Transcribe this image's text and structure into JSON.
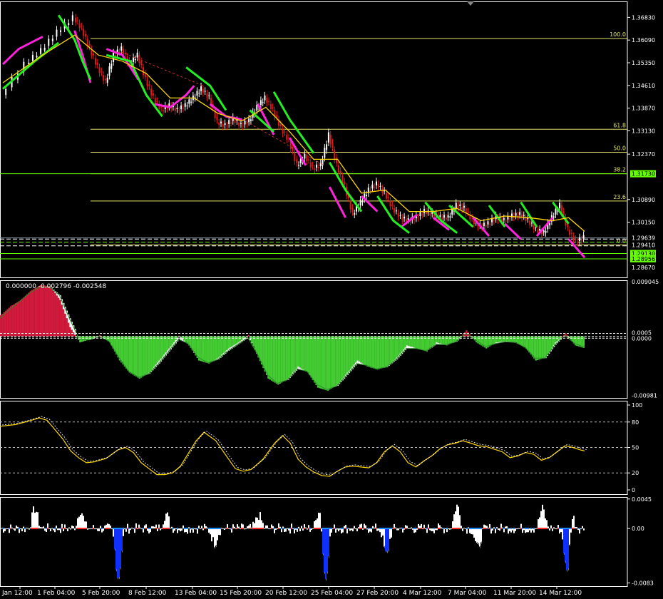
{
  "chart_data": [
    {
      "type": "candlestick",
      "panel": "price",
      "ylim": [
        1.2835,
        1.3735
      ],
      "y_ticks": [
        "1.36830",
        "1.36090",
        "1.35350",
        "1.34610",
        "1.33870",
        "1.33130",
        "1.32370",
        "1.30890",
        "1.30150"
      ],
      "price_tags": [
        {
          "label": "1.31730",
          "value": 1.3173,
          "color": "#66ff00",
          "text_color": "#000000"
        },
        {
          "label": "1.29639",
          "value": 1.29639,
          "color": "#000000",
          "text_color": "#ffffff"
        },
        {
          "label": "1.29410",
          "value": 1.2941,
          "color": "#000000",
          "text_color": "#ffffff"
        },
        {
          "label": "1.29130",
          "value": 1.2913,
          "color": "#66ff00",
          "text_color": "#000000"
        },
        {
          "label": "1.28956",
          "value": 1.28956,
          "color": "#66ff00",
          "text_color": "#000000"
        },
        {
          "label": "1.28670",
          "value": 1.2867,
          "color": "#000000",
          "text_color": "#ffffff"
        }
      ],
      "fib_levels": [
        {
          "label": "100.0",
          "value": 1.3614
        },
        {
          "label": "61.8",
          "value": 1.3318
        },
        {
          "label": "50.0",
          "value": 1.3243
        },
        {
          "label": "38.2",
          "value": 1.3173
        },
        {
          "label": "23.6",
          "value": 1.3084
        },
        {
          "label": "0.0",
          "value": 1.2941
        }
      ],
      "close_path": [
        [
          0,
          1.343
        ],
        [
          3,
          1.353
        ],
        [
          5,
          1.3575
        ],
        [
          7,
          1.3635
        ],
        [
          9,
          1.3682
        ],
        [
          10,
          1.3645
        ],
        [
          11,
          1.358
        ],
        [
          12,
          1.352
        ],
        [
          13,
          1.347
        ],
        [
          14,
          1.356
        ],
        [
          15,
          1.358
        ],
        [
          16,
          1.353
        ],
        [
          17,
          1.356
        ],
        [
          18,
          1.348
        ],
        [
          19,
          1.342
        ],
        [
          20,
          1.338
        ],
        [
          21,
          1.3395
        ],
        [
          22,
          1.338
        ],
        [
          23,
          1.3395
        ],
        [
          24,
          1.342
        ],
        [
          25,
          1.345
        ],
        [
          26,
          1.342
        ],
        [
          27,
          1.334
        ],
        [
          28,
          1.333
        ],
        [
          29,
          1.335
        ],
        [
          30,
          1.333
        ],
        [
          31,
          1.3345
        ],
        [
          32,
          1.339
        ],
        [
          33,
          1.342
        ],
        [
          34,
          1.338
        ],
        [
          35,
          1.332
        ],
        [
          36,
          1.328
        ],
        [
          37,
          1.32
        ],
        [
          38,
          1.323
        ],
        [
          39,
          1.319
        ],
        [
          40,
          1.32
        ],
        [
          41,
          1.33
        ],
        [
          42,
          1.32
        ],
        [
          43,
          1.313
        ],
        [
          44,
          1.304
        ],
        [
          45,
          1.308
        ],
        [
          46,
          1.312
        ],
        [
          47,
          1.314
        ],
        [
          48,
          1.311
        ],
        [
          49,
          1.306
        ],
        [
          50,
          1.303
        ],
        [
          51,
          1.302
        ],
        [
          52,
          1.303
        ],
        [
          53,
          1.305
        ],
        [
          54,
          1.304
        ],
        [
          55,
          1.303
        ],
        [
          56,
          1.303
        ],
        [
          57,
          1.307
        ],
        [
          58,
          1.306
        ],
        [
          59,
          1.302
        ],
        [
          60,
          1.3
        ],
        [
          61,
          1.301
        ],
        [
          62,
          1.303
        ],
        [
          63,
          1.302
        ],
        [
          64,
          1.3035
        ],
        [
          65,
          1.304
        ],
        [
          66,
          1.302
        ],
        [
          67,
          1.299
        ],
        [
          68,
          1.298
        ],
        [
          69,
          1.303
        ],
        [
          70,
          1.307
        ],
        [
          71,
          1.299
        ],
        [
          72,
          1.295
        ],
        [
          73,
          1.2965
        ]
      ],
      "ma_yellow": [
        [
          0,
          1.347
        ],
        [
          5,
          1.356
        ],
        [
          9,
          1.3625
        ],
        [
          12,
          1.356
        ],
        [
          15,
          1.354
        ],
        [
          18,
          1.35
        ],
        [
          21,
          1.342
        ],
        [
          24,
          1.342
        ],
        [
          27,
          1.337
        ],
        [
          30,
          1.3345
        ],
        [
          33,
          1.339
        ],
        [
          36,
          1.331
        ],
        [
          39,
          1.322
        ],
        [
          42,
          1.322
        ],
        [
          45,
          1.311
        ],
        [
          48,
          1.312
        ],
        [
          51,
          1.305
        ],
        [
          54,
          1.305
        ],
        [
          57,
          1.306
        ],
        [
          60,
          1.302
        ],
        [
          63,
          1.3035
        ],
        [
          66,
          1.303
        ],
        [
          69,
          1.302
        ],
        [
          71,
          1.303
        ],
        [
          73,
          1.2985
        ]
      ],
      "green_segments": [
        [
          [
            0,
            1.345
          ],
          [
            4,
            1.354
          ],
          [
            7,
            1.36
          ]
        ],
        [
          [
            7,
            1.369
          ],
          [
            9,
            1.361
          ],
          [
            10,
            1.354
          ],
          [
            11,
            1.348
          ]
        ],
        [
          [
            13,
            1.356
          ],
          [
            16,
            1.354
          ],
          [
            18,
            1.343
          ],
          [
            20,
            1.336
          ]
        ],
        [
          [
            23,
            1.352
          ],
          [
            26,
            1.346
          ],
          [
            28,
            1.338
          ]
        ],
        [
          [
            31,
            1.338
          ],
          [
            34,
            1.331
          ]
        ],
        [
          [
            34,
            1.344
          ],
          [
            36,
            1.335
          ],
          [
            39,
            1.324
          ]
        ],
        [
          [
            41,
            1.321
          ],
          [
            43,
            1.312
          ],
          [
            45,
            1.305
          ]
        ],
        [
          [
            47,
            1.31
          ],
          [
            49,
            1.302
          ],
          [
            51,
            1.298
          ]
        ],
        [
          [
            53,
            1.308
          ],
          [
            55,
            1.302
          ],
          [
            57,
            1.298
          ]
        ],
        [
          [
            56,
            1.307
          ],
          [
            59,
            1.3
          ]
        ],
        [
          [
            61,
            1.307
          ],
          [
            63,
            1.3
          ]
        ],
        [
          [
            65,
            1.308
          ],
          [
            67,
            1.3
          ]
        ],
        [
          [
            69,
            1.308
          ],
          [
            71,
            1.301
          ]
        ]
      ],
      "magenta_segments": [
        [
          [
            0,
            1.353
          ],
          [
            2,
            1.358
          ],
          [
            5,
            1.362
          ]
        ],
        [
          [
            9,
            1.364
          ],
          [
            10,
            1.356
          ],
          [
            11,
            1.347
          ]
        ],
        [
          [
            13,
            1.358
          ],
          [
            15,
            1.356
          ],
          [
            17,
            1.348
          ]
        ],
        [
          [
            19,
            1.34
          ],
          [
            21,
            1.339
          ],
          [
            23,
            1.343
          ],
          [
            24,
            1.346
          ]
        ],
        [
          [
            26,
            1.34
          ],
          [
            28,
            1.336
          ],
          [
            30,
            1.335
          ]
        ],
        [
          [
            32,
            1.34
          ],
          [
            34,
            1.33
          ]
        ],
        [
          [
            36,
            1.329
          ],
          [
            38,
            1.32
          ]
        ],
        [
          [
            41,
            1.313
          ],
          [
            43,
            1.303
          ]
        ],
        [
          [
            45,
            1.31
          ],
          [
            47,
            1.305
          ]
        ],
        [
          [
            50,
            1.3
          ],
          [
            52,
            1.304
          ]
        ],
        [
          [
            54,
            1.303
          ],
          [
            56,
            1.299
          ]
        ],
        [
          [
            59,
            1.303
          ],
          [
            61,
            1.297
          ]
        ],
        [
          [
            63,
            1.301
          ],
          [
            65,
            1.296
          ]
        ],
        [
          [
            67,
            1.297
          ],
          [
            69,
            1.303
          ]
        ],
        [
          [
            71,
            1.296
          ],
          [
            73,
            1.29
          ]
        ]
      ]
    },
    {
      "type": "histogram",
      "panel": "oscillator",
      "header": "0.000000 -0.002796 -0.002548",
      "ylim": [
        -0.0102,
        0.0093
      ],
      "y_ticks": [
        "0.009045",
        "-0.00981"
      ],
      "level_tags": [
        "0.0005",
        "0.0000"
      ],
      "values": [
        0.0035,
        0.005,
        0.006,
        0.0075,
        0.0085,
        0.0083,
        0.006,
        0.0015,
        -0.001,
        -0.0005,
        0.0002,
        -0.001,
        -0.004,
        -0.006,
        -0.007,
        -0.006,
        -0.004,
        -0.002,
        0.0001,
        -0.0015,
        -0.004,
        -0.0045,
        -0.0035,
        -0.002,
        -0.001,
        0.0002,
        -0.0035,
        -0.007,
        -0.008,
        -0.007,
        -0.005,
        -0.006,
        -0.0085,
        -0.009,
        -0.008,
        -0.006,
        -0.004,
        -0.005,
        -0.0055,
        -0.005,
        -0.0035,
        -0.0015,
        -0.002,
        -0.0025,
        -0.001,
        -0.0015,
        -0.0008,
        0.001,
        -0.001,
        -0.002,
        -0.001,
        -0.0008,
        -0.001,
        -0.002,
        -0.004,
        -0.0035,
        -0.001,
        0.0005,
        -0.0015,
        -0.002
      ],
      "signal": [
        0.003,
        0.0045,
        0.0058,
        0.0072,
        0.0082,
        0.0082,
        0.0068,
        0.003,
        -0.0005,
        -0.0006,
        0.0,
        -0.0008,
        -0.0035,
        -0.0058,
        -0.0068,
        -0.0062,
        -0.0045,
        -0.0025,
        -0.0005,
        -0.0012,
        -0.0035,
        -0.0044,
        -0.0038,
        -0.0024,
        -0.0013,
        -0.0002,
        -0.003,
        -0.0064,
        -0.0078,
        -0.0072,
        -0.0054,
        -0.0058,
        -0.008,
        -0.0088,
        -0.0082,
        -0.0064,
        -0.0045,
        -0.0048,
        -0.0054,
        -0.0051,
        -0.0038,
        -0.002,
        -0.002,
        -0.0024,
        -0.0013,
        -0.0014,
        -0.0009,
        0.0005,
        -0.0006,
        -0.0017,
        -0.0012,
        -0.0009,
        -0.001,
        -0.0018,
        -0.0036,
        -0.0036,
        -0.0014,
        0.0002,
        -0.0012,
        -0.0018
      ]
    },
    {
      "type": "line",
      "panel": "stochastic",
      "ylim": [
        0,
        100
      ],
      "y_ticks": [
        "100",
        "80",
        "50",
        "20",
        "0"
      ],
      "levels": [
        80,
        50,
        20
      ],
      "series": [
        {
          "color": "#ffd700",
          "values": [
            [
              0,
              75
            ],
            [
              4,
              77
            ],
            [
              8,
              82
            ],
            [
              10,
              85
            ],
            [
              12,
              82
            ],
            [
              16,
              60
            ],
            [
              18,
              46
            ],
            [
              20,
              38
            ],
            [
              22,
              32
            ],
            [
              24,
              33
            ],
            [
              27,
              37
            ],
            [
              30,
              47
            ],
            [
              32,
              50
            ],
            [
              34,
              44
            ],
            [
              36,
              32
            ],
            [
              38,
              25
            ],
            [
              40,
              18
            ],
            [
              42,
              18
            ],
            [
              44,
              20
            ],
            [
              46,
              28
            ],
            [
              48,
              43
            ],
            [
              50,
              58
            ],
            [
              52,
              68
            ],
            [
              55,
              58
            ],
            [
              58,
              38
            ],
            [
              60,
              25
            ],
            [
              62,
              22
            ],
            [
              64,
              24
            ],
            [
              67,
              36
            ],
            [
              70,
              55
            ],
            [
              72,
              64
            ],
            [
              74,
              55
            ],
            [
              76,
              36
            ],
            [
              78,
              27
            ],
            [
              80,
              21
            ],
            [
              82,
              17
            ],
            [
              84,
              16
            ],
            [
              86,
              22
            ],
            [
              88,
              27
            ],
            [
              90,
              28
            ],
            [
              92,
              27
            ],
            [
              94,
              26
            ],
            [
              96,
              32
            ],
            [
              98,
              45
            ],
            [
              100,
              52
            ],
            [
              102,
              45
            ],
            [
              104,
              32
            ],
            [
              106,
              27
            ],
            [
              108,
              34
            ],
            [
              110,
              40
            ],
            [
              112,
              48
            ],
            [
              114,
              53
            ],
            [
              116,
              55
            ],
            [
              118,
              58
            ],
            [
              120,
              55
            ],
            [
              122,
              52
            ],
            [
              124,
              51
            ],
            [
              126,
              48
            ],
            [
              128,
              45
            ],
            [
              130,
              38
            ],
            [
              132,
              40
            ],
            [
              134,
              44
            ],
            [
              136,
              42
            ],
            [
              138,
              35
            ],
            [
              140,
              38
            ],
            [
              142,
              45
            ],
            [
              144,
              52
            ],
            [
              146,
              50
            ],
            [
              148,
              47
            ],
            [
              149,
              46
            ]
          ]
        }
      ]
    },
    {
      "type": "histogram",
      "panel": "volume-oscillator",
      "ylim": [
        -0.0088,
        0.0048
      ],
      "y_ticks": [
        "0.0045",
        "0.00",
        "-0.0083"
      ]
    }
  ],
  "x_ticks": [
    "Jan 12:00",
    "1 Feb 04:00",
    "5 Feb 20:00",
    "8 Feb 12:00",
    "13 Feb 04:00",
    "15 Feb 20:00",
    "20 Feb 12:00",
    "25 Feb 04:00",
    "27 Feb 20:00",
    "4 Mar 12:00",
    "7 Mar 04:00",
    "11 Mar 20:00",
    "14 Mar 12:00"
  ],
  "colors": {
    "background": "#000000",
    "axis": "#ffffff",
    "grid_dash": "#ffffff",
    "fib": "#e6e66a",
    "ma_yellow": "#ffd700",
    "bull_green": "#22ee22",
    "bear_magenta": "#ff22dd",
    "hist_red": "#d21a3c",
    "hist_green": "#44cc33",
    "hist_white": "#ffffff",
    "tag_green": "#66ff00"
  }
}
